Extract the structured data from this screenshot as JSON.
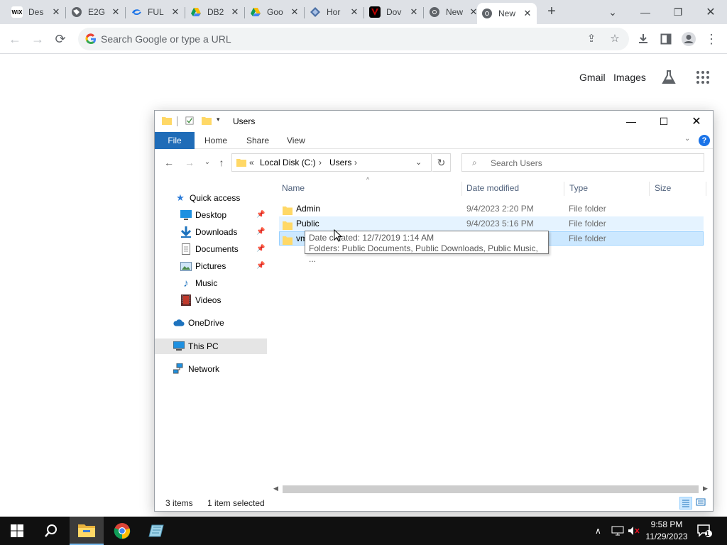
{
  "browser": {
    "tabs": [
      {
        "title": "Des",
        "icon": "wix-icon",
        "color": "#000000"
      },
      {
        "title": "E2G",
        "icon": "globe-icon",
        "color": "#5f6368"
      },
      {
        "title": "FUL",
        "icon": "swirl-icon",
        "color": "#1a73e8"
      },
      {
        "title": "DB2",
        "icon": "google-drive-icon",
        "color": "#0f9d58"
      },
      {
        "title": "Goo",
        "icon": "google-drive-icon",
        "color": "#0f9d58"
      },
      {
        "title": "Hor",
        "icon": "diamond-icon",
        "color": "#4a6fa5"
      },
      {
        "title": "Dov",
        "icon": "logo-v-icon",
        "color": "#c00000"
      },
      {
        "title": "New",
        "icon": "chrome-icon",
        "color": "#5f6368"
      },
      {
        "title": "New",
        "icon": "chrome-icon",
        "color": "#5f6368",
        "active": true
      }
    ],
    "omnibox_placeholder": "Search Google or type a URL",
    "links": {
      "gmail": "Gmail",
      "images": "Images"
    }
  },
  "explorer": {
    "title": "Users",
    "ribbon_tabs": [
      "File",
      "Home",
      "Share",
      "View"
    ],
    "help": "?",
    "address": {
      "prefix": "«",
      "crumbs": [
        "Local Disk (C:)",
        "Users"
      ],
      "separator": "›"
    },
    "search_placeholder": "Search Users",
    "nav": {
      "quick_access": "Quick access",
      "items": [
        "Desktop",
        "Downloads",
        "Documents",
        "Pictures",
        "Music",
        "Videos"
      ],
      "onedrive": "OneDrive",
      "this_pc": "This PC",
      "network": "Network"
    },
    "columns": {
      "name": "Name",
      "date": "Date modified",
      "type": "Type",
      "size": "Size"
    },
    "files": [
      {
        "name": "Admin",
        "date": "9/4/2023 2:20 PM",
        "type": "File folder"
      },
      {
        "name": "Public",
        "date": "9/4/2023 5:16 PM",
        "type": "File folder"
      },
      {
        "name": "vm",
        "date": "",
        "type": "File folder"
      }
    ],
    "tooltip": {
      "line1": "Date created: 12/7/2019 1:14 AM",
      "line2": "Folders: Public Documents, Public Downloads, Public Music, ..."
    },
    "status": {
      "count": "3 items",
      "selected": "1 item selected"
    }
  },
  "taskbar": {
    "time": "9:58 PM",
    "date": "11/29/2023",
    "notifications": "1"
  },
  "colors": {
    "accent": "#1f6cb8",
    "selection": "#cce8ff",
    "hover": "#e5f3ff",
    "folder": "#ffd866"
  }
}
